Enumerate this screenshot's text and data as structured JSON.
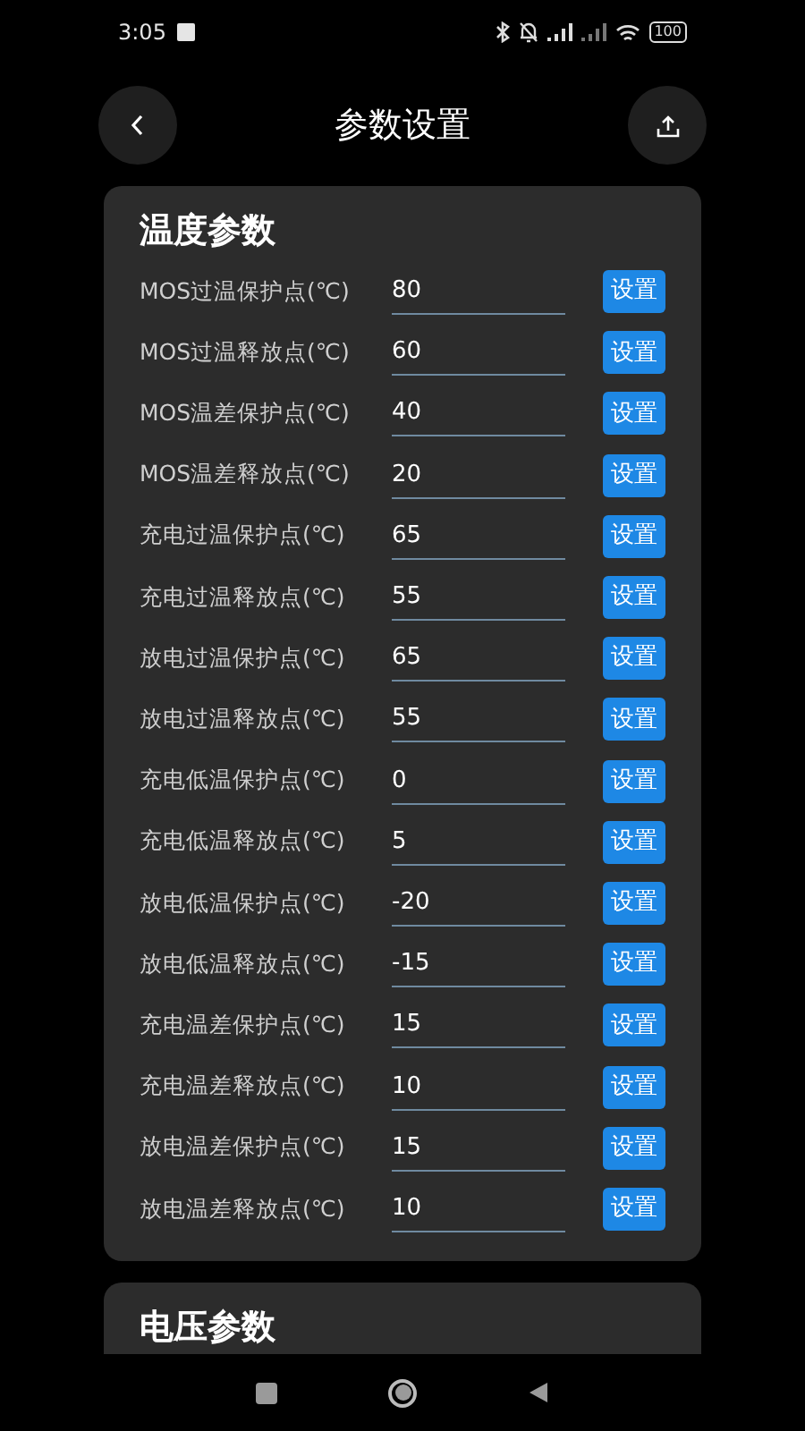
{
  "status_bar": {
    "time": "3:05",
    "battery": "100"
  },
  "header": {
    "title": "参数设置"
  },
  "sections": [
    {
      "title": "温度参数",
      "rows": [
        {
          "label": "MOS过温保护点(℃)",
          "value": "80",
          "button": "设置"
        },
        {
          "label": "MOS过温释放点(℃)",
          "value": "60",
          "button": "设置"
        },
        {
          "label": "MOS温差保护点(℃)",
          "value": "40",
          "button": "设置"
        },
        {
          "label": "MOS温差释放点(℃)",
          "value": "20",
          "button": "设置"
        },
        {
          "label": "充电过温保护点(℃)",
          "value": "65",
          "button": "设置"
        },
        {
          "label": "充电过温释放点(℃)",
          "value": "55",
          "button": "设置"
        },
        {
          "label": "放电过温保护点(℃)",
          "value": "65",
          "button": "设置"
        },
        {
          "label": "放电过温释放点(℃)",
          "value": "55",
          "button": "设置"
        },
        {
          "label": "充电低温保护点(℃)",
          "value": "0",
          "button": "设置"
        },
        {
          "label": "充电低温释放点(℃)",
          "value": "5",
          "button": "设置"
        },
        {
          "label": "放电低温保护点(℃)",
          "value": "-20",
          "button": "设置"
        },
        {
          "label": "放电低温释放点(℃)",
          "value": "-15",
          "button": "设置"
        },
        {
          "label": "充电温差保护点(℃)",
          "value": "15",
          "button": "设置"
        },
        {
          "label": "充电温差释放点(℃)",
          "value": "10",
          "button": "设置"
        },
        {
          "label": "放电温差保护点(℃)",
          "value": "15",
          "button": "设置"
        },
        {
          "label": "放电温差释放点(℃)",
          "value": "10",
          "button": "设置"
        }
      ]
    },
    {
      "title": "电压参数"
    }
  ]
}
